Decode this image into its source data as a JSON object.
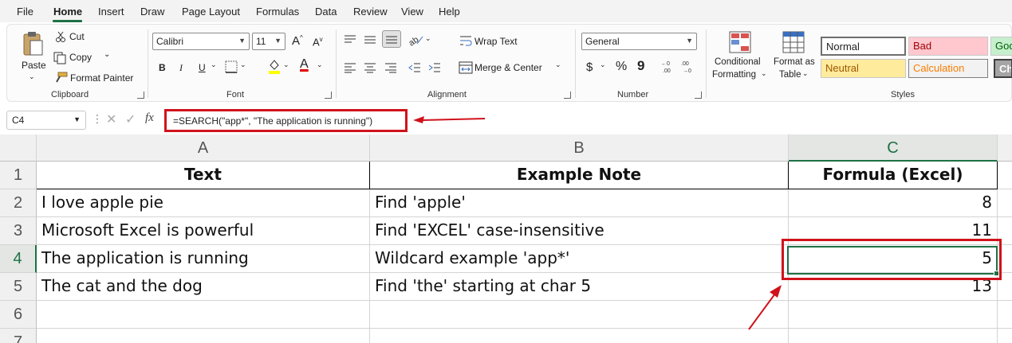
{
  "menu": {
    "tabs": [
      "File",
      "Home",
      "Insert",
      "Draw",
      "Page Layout",
      "Formulas",
      "Data",
      "Review",
      "View",
      "Help"
    ],
    "active": "Home"
  },
  "ribbon": {
    "clipboard": {
      "paste": "Paste",
      "cut": "Cut",
      "copy": "Copy",
      "format_painter": "Format Painter",
      "label": "Clipboard"
    },
    "font": {
      "name": "Calibri",
      "size": "11",
      "label": "Font",
      "bold": "B",
      "italic": "I",
      "underline": "U",
      "grow": "A",
      "shrink": "A"
    },
    "alignment": {
      "wrap_text": "Wrap Text",
      "merge_center": "Merge & Center",
      "label": "Alignment"
    },
    "number": {
      "format": "General",
      "currency": "$",
      "percent": "%",
      "comma": "9",
      "label": "Number"
    },
    "styles": {
      "conditional_formatting_1": "Conditional",
      "conditional_formatting_2": "Formatting",
      "format_table_1": "Format as",
      "format_table_2": "Table",
      "label": "Styles",
      "cells": [
        "Normal",
        "Bad",
        "Goo",
        "Neutral",
        "Calculation",
        "Che"
      ]
    }
  },
  "formula_bar": {
    "name_box": "C4",
    "fx": "fx",
    "formula": "=SEARCH(\"app*\", \"The application is running\")"
  },
  "sheet": {
    "columns": [
      "A",
      "B",
      "C"
    ],
    "rows": [
      "1",
      "2",
      "3",
      "4",
      "5",
      "6",
      "7"
    ],
    "headers": [
      "Text",
      "Example Note",
      "Formula (Excel)"
    ],
    "data": [
      [
        "I love apple pie",
        "Find 'apple'",
        "8"
      ],
      [
        "Microsoft Excel is powerful",
        "Find 'EXCEL' case-insensitive",
        "11"
      ],
      [
        "The application is running",
        "Wildcard example 'app*'",
        "5"
      ],
      [
        "The cat and the dog",
        "Find 'the' starting at char 5",
        "13"
      ]
    ],
    "selected_cell": "C4"
  },
  "colors": {
    "excel_green": "#1e7145",
    "annotation_red": "#d0121b"
  }
}
